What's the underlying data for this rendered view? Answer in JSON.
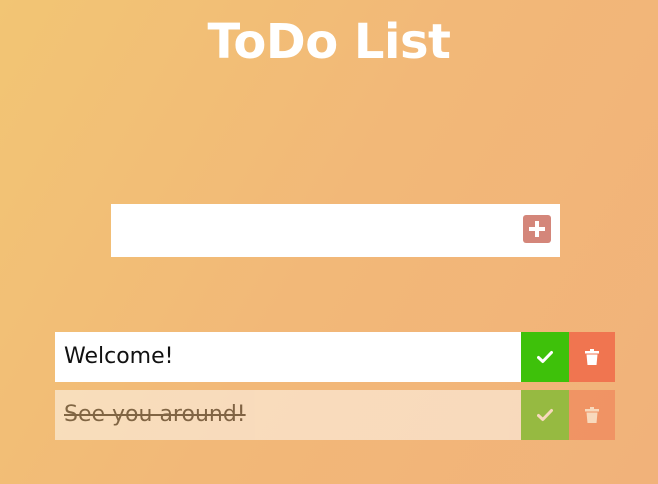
{
  "header": {
    "title": "ToDo List"
  },
  "add_form": {
    "input_value": "",
    "input_placeholder": "",
    "button_icon": "plus-square-icon",
    "button_color": "#d4867a"
  },
  "todos": [
    {
      "text": "Welcome!",
      "completed": false
    },
    {
      "text": "See you around!",
      "completed": true
    }
  ],
  "actions": {
    "complete_icon": "check-icon",
    "complete_color": "#3ec10a",
    "delete_icon": "trash-icon",
    "delete_color": "#f07550"
  },
  "theme": {
    "background_start": "#f2c574",
    "background_end": "#f1b27a",
    "title_color": "#ffffff"
  }
}
